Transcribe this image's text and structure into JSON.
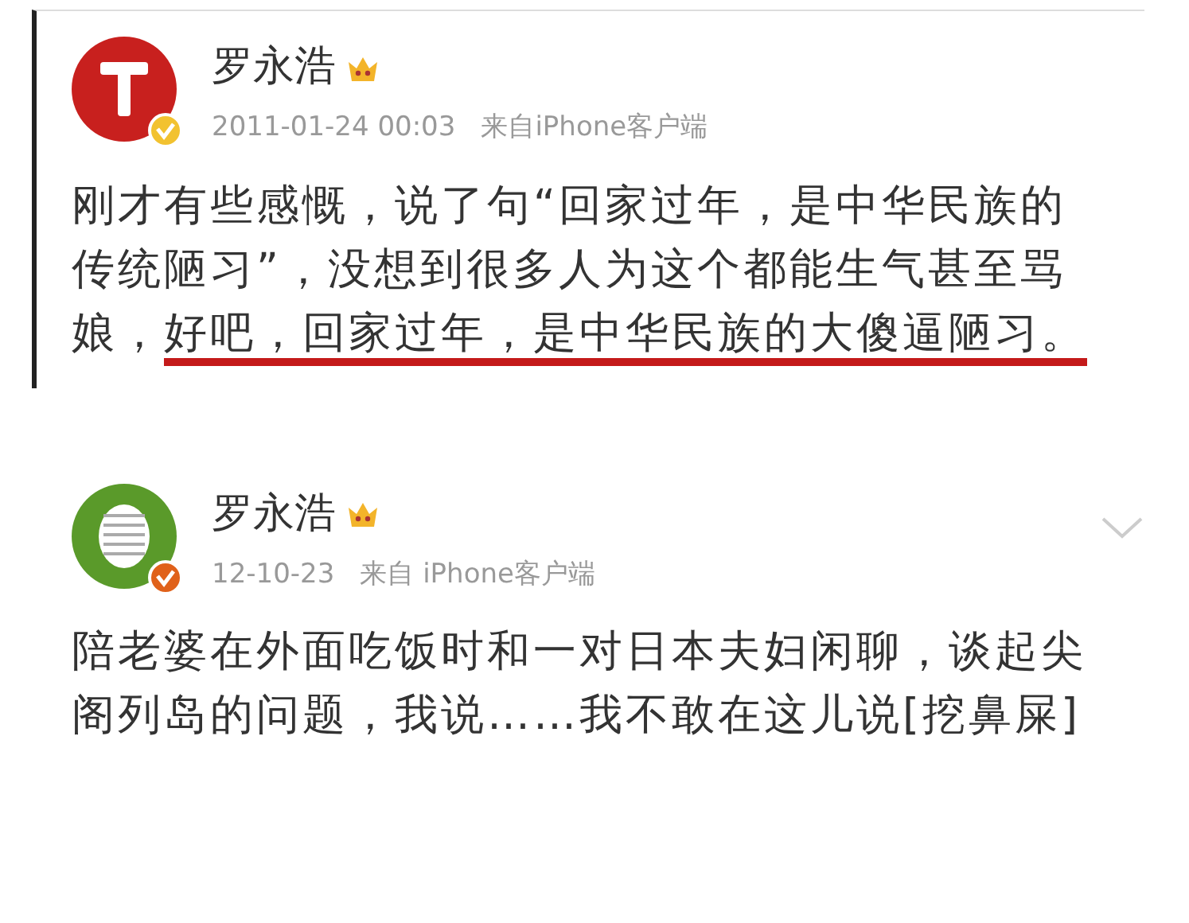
{
  "posts": [
    {
      "name": "罗永浩",
      "time": "2011-01-24 00:03",
      "source": "来自iPhone客户端",
      "avatar": {
        "kind": "letter-logo",
        "color": "#c8201e"
      },
      "verified_badge": {
        "color": "#f2c230"
      },
      "bordered": true,
      "has_menu": false,
      "text": [
        {
          "text": "刚才有些感慨，说了句“回家过年，是中华民族的传统陋习”，没想到很多人为这个都能生气甚至骂娘，",
          "underlined": false
        },
        {
          "text": "好吧，回家过年，是中华民族的大傻逼陋习。",
          "underlined": true
        }
      ]
    },
    {
      "name": "罗永浩",
      "time": "12-10-23",
      "source": "来自 iPhone客户端",
      "avatar": {
        "kind": "egg-logo",
        "color": "#5a9a2a"
      },
      "verified_badge": {
        "color": "#e0611a"
      },
      "bordered": false,
      "has_menu": true,
      "text": [
        {
          "text": "陪老婆在外面吃饭时和一对日本夫妇闲聊，谈起尖阁列岛的问题，我说……我不敢在这儿说[挖鼻屎]",
          "underlined": false
        }
      ]
    }
  ]
}
